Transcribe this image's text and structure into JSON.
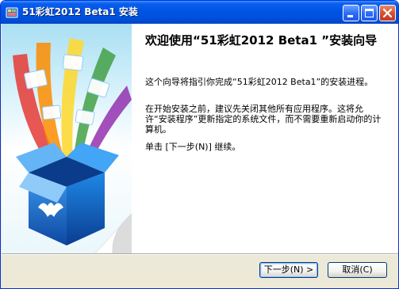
{
  "window": {
    "title": "51彩虹2012 Beta1 安装"
  },
  "page": {
    "heading": "欢迎使用“51彩虹2012 Beta1 ”安装向导",
    "paragraphs": [
      "这个向导将指引你完成“51彩虹2012 Beta1”的安装进程。",
      "在开始安装之前，建议先关闭其他所有应用程序。这将允许“安装程序”更新指定的系统文件，而不需要重新启动你的计算机。",
      "单击 [下一步(N)] 继续。"
    ]
  },
  "buttons": {
    "next_label": "下一步(N) >",
    "cancel_label": "取消(C)"
  },
  "colors": {
    "titlebar": "#0054e3",
    "frame": "#0831d9",
    "dialog_bg": "#ece9d8",
    "close_button": "#d65130",
    "box_blue": "#1565c0"
  },
  "icons": {
    "app": "installer-app-icon",
    "minimize": "minimize-icon",
    "maximize": "maximize-icon",
    "close": "close-icon",
    "banner": "rainbow-box-banner"
  }
}
